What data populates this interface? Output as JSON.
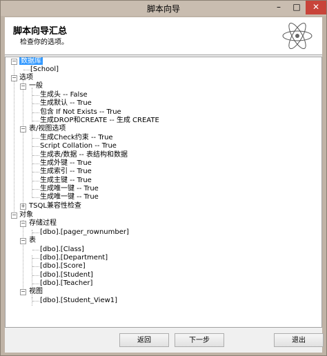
{
  "window": {
    "title": "脚本向导",
    "minimize": "–",
    "maximize": "□",
    "close": "✕"
  },
  "header": {
    "title": "脚本向导汇总",
    "subtitle": "检查你的选项。"
  },
  "tree": {
    "database_label": "数据库",
    "database_item": "[School]",
    "options_label": "选项",
    "general_label": "一般",
    "general_items": [
      "生成头 -- False",
      "生成默认 -- True",
      "包含 If Not Exists -- True",
      "生成DROP和CREATE -- 生成 CREATE"
    ],
    "table_view_label": "表/视图选项",
    "table_view_items": [
      "生成Check约束 -- True",
      "Script Collation -- True",
      "生成表/数据 -- 表结构和数据",
      "生成外键 -- True",
      "生成索引 -- True",
      "生成主键 -- True",
      "生成唯一键 -- True",
      "生成唯一键 -- True"
    ],
    "tsql_label": "TSQL兼容性检查",
    "objects_label": "对象",
    "procs_label": "存储过程",
    "procs_items": [
      "[dbo].[pager_rownumber]"
    ],
    "tables_label": "表",
    "tables_items": [
      "[dbo].[Class]",
      "[dbo].[Department]",
      "[dbo].[Score]",
      "[dbo].[Student]",
      "[dbo].[Teacher]"
    ],
    "views_label": "视图",
    "views_items": [
      "[dbo].[Student_View1]"
    ]
  },
  "footer": {
    "back": "返回",
    "next": "下一步",
    "exit": "退出"
  }
}
